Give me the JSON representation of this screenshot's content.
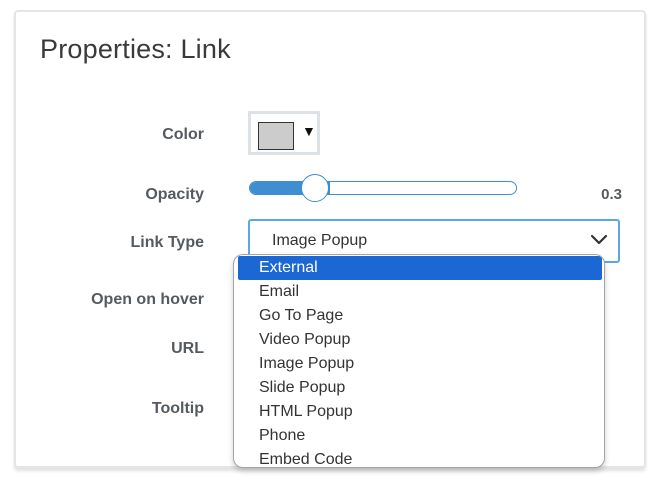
{
  "panel": {
    "title": "Properties: Link"
  },
  "fields": {
    "color_label": "Color",
    "opacity_label": "Opacity",
    "link_type_label": "Link Type",
    "open_on_hover_label": "Open on hover",
    "url_label": "URL",
    "tooltip_label": "Tooltip"
  },
  "color": {
    "swatch_hex": "#cccccc",
    "arrow": "▼"
  },
  "opacity": {
    "value": 0.3,
    "display": "0.3"
  },
  "link_type": {
    "selected_value": "Image Popup",
    "options": [
      "External",
      "Email",
      "Go To Page",
      "Video Popup",
      "Image Popup",
      "Slide Popup",
      "HTML Popup",
      "Phone",
      "Embed Code"
    ],
    "highlighted_option": "External"
  },
  "colors": {
    "accent": "#3d8fd1",
    "highlight": "#1b67d3",
    "label_text": "#555a5f"
  }
}
